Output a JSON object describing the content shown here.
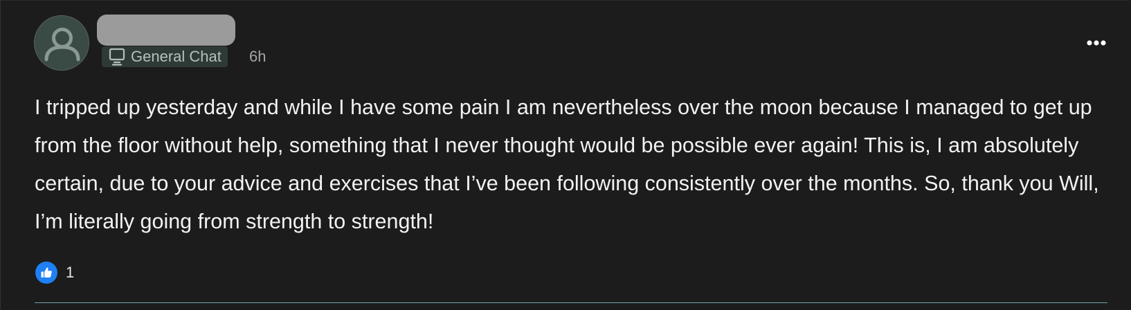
{
  "post": {
    "author": {
      "name": "",
      "avatar_icon": "user-silhouette-icon"
    },
    "channel": {
      "icon": "monitor-icon",
      "label": "General Chat"
    },
    "time": "6h",
    "more_icon": "ellipsis-icon",
    "body": "I tripped up yesterday and while I have some pain I am nevertheless over the moon because I managed to get up from the floor without help, something that I never thought would be possible ever again! This is, I am absolutely certain, due to your advice and exercises that I’ve been following consistently over the months. So, thank you Will, I’m literally going from strength to strength!",
    "reactions": {
      "icon": "thumbs-up-icon",
      "count": "1"
    }
  },
  "colors": {
    "background": "#1c1c1c",
    "text": "#f2f2f2",
    "like_blue": "#1f7ff5",
    "chip_bg": "#2e3a35",
    "divider": "#6fa4a8"
  }
}
